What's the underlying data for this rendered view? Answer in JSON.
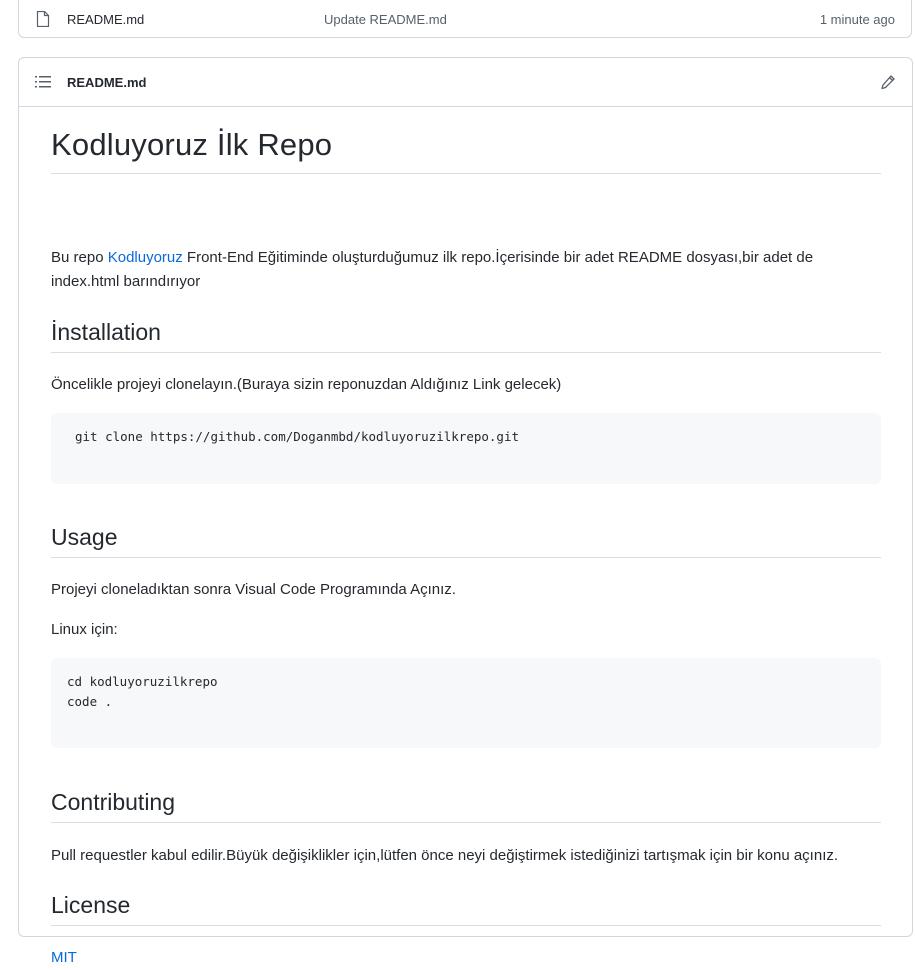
{
  "file_row": {
    "icon": "file-icon",
    "name": "README.md",
    "commit_message": "Update README.md",
    "time": "1 minute ago"
  },
  "readme": {
    "header": {
      "title": "README.md",
      "list_icon": "list-icon",
      "edit_icon": "pencil-icon"
    },
    "h1": "Kodluyoruz İlk Repo",
    "intro": {
      "prefix": "Bu repo ",
      "link": "Kodluyoruz",
      "suffix": " Front-End Eğitiminde oluşturduğumuz ilk repo.İçerisinde bir adet README dosyası,bir adet de index.html barındırıyor"
    },
    "installation": {
      "heading": "İnstallation",
      "text": "Öncelikle projeyi clonelayın.(Buraya sizin reponuzdan Aldığınız Link gelecek)",
      "code": "git clone https://github.com/Doganmbd/kodluyoruzilkrepo.git"
    },
    "usage": {
      "heading": "Usage",
      "text1": "Projeyi cloneladıktan sonra Visual Code Programında Açınız.",
      "text2": "Linux için:",
      "code": "cd kodluyoruzilkrepo\ncode ."
    },
    "contributing": {
      "heading": "Contributing",
      "text": "Pull requestler kabul edilir.Büyük değişiklikler için,lütfen önce neyi değiştirmek istediğinizi tartışmak için bir konu açınız."
    },
    "license": {
      "heading": "License",
      "link": "MIT"
    }
  },
  "colors": {
    "link": "#0969da",
    "border": "#d0d7de",
    "code_bg": "#f6f8fa",
    "text": "#24292f",
    "muted": "#57606a"
  }
}
